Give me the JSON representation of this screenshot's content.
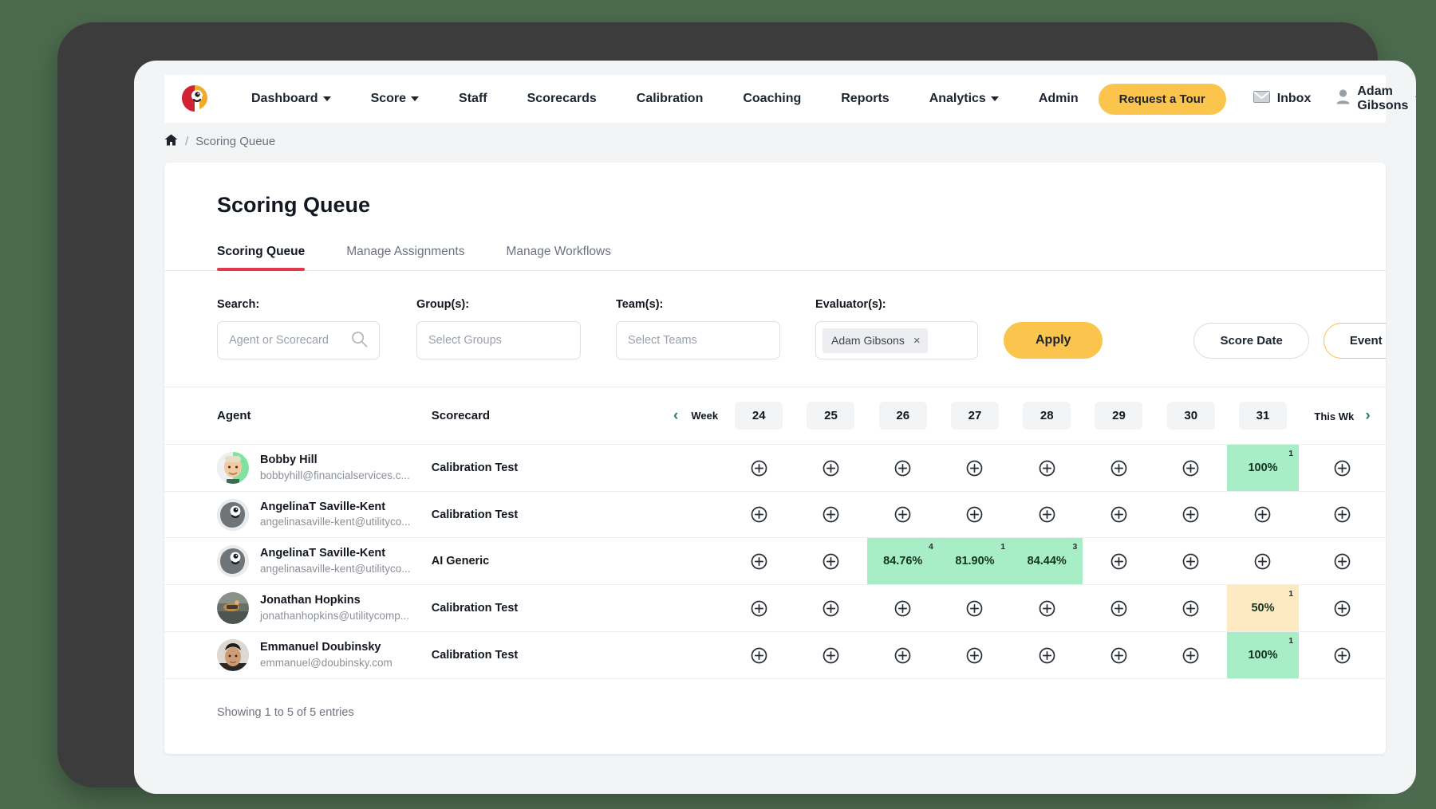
{
  "navbar": {
    "logo_name": "parrot-logo",
    "links": [
      {
        "label": "Dashboard",
        "caret": true
      },
      {
        "label": "Score",
        "caret": true
      },
      {
        "label": "Staff",
        "caret": false
      },
      {
        "label": "Scorecards",
        "caret": false
      },
      {
        "label": "Calibration",
        "caret": false
      },
      {
        "label": "Coaching",
        "caret": false
      },
      {
        "label": "Reports",
        "caret": false
      },
      {
        "label": "Analytics",
        "caret": true
      },
      {
        "label": "Admin",
        "caret": false
      }
    ],
    "tour_button": "Request a Tour",
    "inbox_label": "Inbox",
    "user_name": "Adam Gibsons",
    "grid_icon": "grid-table-icon",
    "accent_yellow": "#fbc44d"
  },
  "breadcrumb": {
    "home_icon": "home-icon",
    "separator": "/",
    "current": "Scoring Queue"
  },
  "page": {
    "title": "Scoring Queue",
    "tabs": [
      {
        "label": "Scoring Queue",
        "active": true
      },
      {
        "label": "Manage Assignments",
        "active": false
      },
      {
        "label": "Manage Workflows",
        "active": false
      }
    ],
    "active_tab_color": "#e0394b"
  },
  "filters": {
    "search": {
      "label": "Search:",
      "value": "",
      "placeholder": "Agent or Scorecard",
      "icon": "search-icon"
    },
    "groups": {
      "label": "Group(s):",
      "value": "",
      "placeholder": "Select Groups"
    },
    "teams": {
      "label": "Team(s):",
      "value": "",
      "placeholder": "Select Teams"
    },
    "evaluators": {
      "label": "Evaluator(s):",
      "chip": "Adam Gibsons",
      "chip_remove": "×"
    },
    "apply_button": "Apply",
    "score_date_button": "Score Date",
    "event_date_button": "Event Date",
    "selected_date_button": "Event Date"
  },
  "table": {
    "headers": {
      "agent": "Agent",
      "scorecard": "Scorecard",
      "week_label": "Week",
      "this_week": "This Wk",
      "prev_icon": "chevron-left-icon",
      "next_icon": "chevron-right-icon"
    },
    "weeks": [
      "24",
      "25",
      "26",
      "27",
      "28",
      "29",
      "30",
      "31"
    ],
    "cell_add_icon": "circle-plus-icon",
    "colors": {
      "green": "#a7edc6",
      "amber": "#fdeac2"
    },
    "rows": [
      {
        "avatar": "avatar-bobby-hill",
        "name": "Bobby Hill",
        "email": "bobbyhill@financialservices.c...",
        "scorecard": "Calibration Test",
        "cells": [
          {
            "type": "add"
          },
          {
            "type": "add"
          },
          {
            "type": "add"
          },
          {
            "type": "add"
          },
          {
            "type": "add"
          },
          {
            "type": "add"
          },
          {
            "type": "add"
          },
          {
            "type": "score",
            "value": "100%",
            "count": "1",
            "color": "green"
          },
          {
            "type": "add"
          }
        ]
      },
      {
        "avatar": "avatar-angelinat-saville-kent",
        "name": "AngelinaT Saville-Kent",
        "email": "angelinasaville-kent@utilityco...",
        "scorecard": "Calibration Test",
        "cells": [
          {
            "type": "add"
          },
          {
            "type": "add"
          },
          {
            "type": "add"
          },
          {
            "type": "add"
          },
          {
            "type": "add"
          },
          {
            "type": "add"
          },
          {
            "type": "add"
          },
          {
            "type": "add"
          },
          {
            "type": "add"
          }
        ]
      },
      {
        "avatar": "avatar-angelinat-saville-kent",
        "name": "AngelinaT Saville-Kent",
        "email": "angelinasaville-kent@utilityco...",
        "scorecard": "AI Generic",
        "cells": [
          {
            "type": "add"
          },
          {
            "type": "add"
          },
          {
            "type": "score",
            "value": "84.76%",
            "count": "4",
            "color": "green"
          },
          {
            "type": "score",
            "value": "81.90%",
            "count": "1",
            "color": "green"
          },
          {
            "type": "score",
            "value": "84.44%",
            "count": "3",
            "color": "green"
          },
          {
            "type": "add"
          },
          {
            "type": "add"
          },
          {
            "type": "add"
          },
          {
            "type": "add"
          }
        ]
      },
      {
        "avatar": "avatar-jonathan-hopkins",
        "name": "Jonathan Hopkins",
        "email": "jonathanhopkins@utilitycomp...",
        "scorecard": "Calibration Test",
        "cells": [
          {
            "type": "add"
          },
          {
            "type": "add"
          },
          {
            "type": "add"
          },
          {
            "type": "add"
          },
          {
            "type": "add"
          },
          {
            "type": "add"
          },
          {
            "type": "add"
          },
          {
            "type": "score",
            "value": "50%",
            "count": "1",
            "color": "amber"
          },
          {
            "type": "add"
          }
        ]
      },
      {
        "avatar": "avatar-emmanuel-doubinsky",
        "name": "Emmanuel Doubinsky",
        "email": "emmanuel@doubinsky.com",
        "scorecard": "Calibration Test",
        "cells": [
          {
            "type": "add"
          },
          {
            "type": "add"
          },
          {
            "type": "add"
          },
          {
            "type": "add"
          },
          {
            "type": "add"
          },
          {
            "type": "add"
          },
          {
            "type": "add"
          },
          {
            "type": "score",
            "value": "100%",
            "count": "1",
            "color": "green"
          },
          {
            "type": "add"
          }
        ]
      }
    ],
    "footer": "Showing 1 to 5 of 5 entries"
  }
}
